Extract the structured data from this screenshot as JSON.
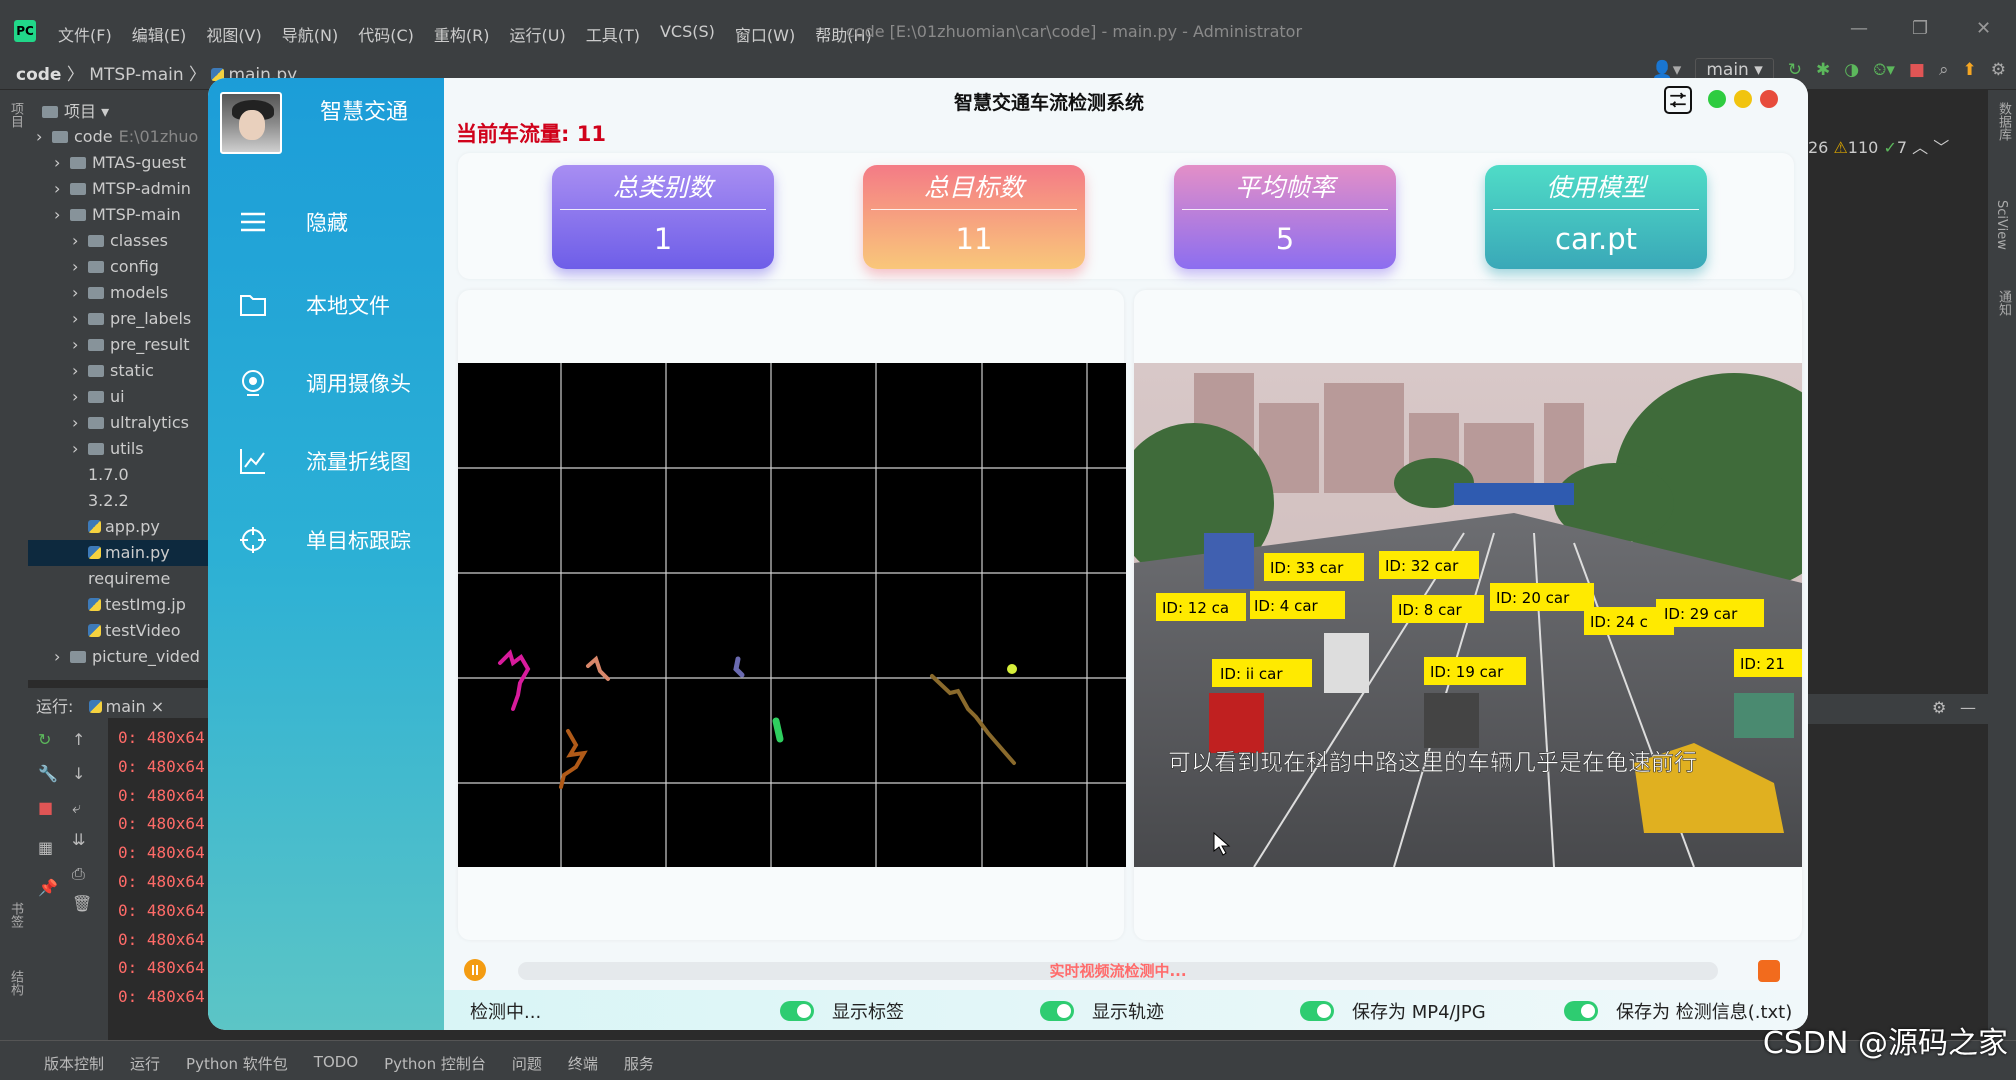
{
  "ide": {
    "logo": "PC",
    "menus": [
      "文件(F)",
      "编辑(E)",
      "视图(V)",
      "导航(N)",
      "代码(C)",
      "重构(R)",
      "运行(U)",
      "工具(T)",
      "VCS(S)",
      "窗口(W)",
      "帮助(H)"
    ],
    "window_title": "code [E:\\01zhuomian\\car\\code] - main.py - Administrator",
    "breadcrumb": [
      "code",
      "MTSP-main",
      "main.py"
    ],
    "branch": "main",
    "project_label": "项目",
    "tree": [
      {
        "name": "code",
        "path": "E:\\01zhuo",
        "level": 0,
        "type": "folder"
      },
      {
        "name": "MTAS-guest",
        "level": 1,
        "type": "folder"
      },
      {
        "name": "MTSP-admin",
        "level": 1,
        "type": "folder"
      },
      {
        "name": "MTSP-main",
        "level": 1,
        "type": "folder"
      },
      {
        "name": "classes",
        "level": 2,
        "type": "folder"
      },
      {
        "name": "config",
        "level": 2,
        "type": "folder"
      },
      {
        "name": "models",
        "level": 2,
        "type": "folder"
      },
      {
        "name": "pre_labels",
        "level": 2,
        "type": "folder"
      },
      {
        "name": "pre_result",
        "level": 2,
        "type": "folder"
      },
      {
        "name": "static",
        "level": 2,
        "type": "folder"
      },
      {
        "name": "ui",
        "level": 2,
        "type": "folder"
      },
      {
        "name": "ultralytics",
        "level": 2,
        "type": "folder"
      },
      {
        "name": "utils",
        "level": 2,
        "type": "folder"
      },
      {
        "name": "1.7.0",
        "level": 2,
        "type": "file"
      },
      {
        "name": "3.2.2",
        "level": 2,
        "type": "file"
      },
      {
        "name": "app.py",
        "level": 2,
        "type": "py"
      },
      {
        "name": "main.py",
        "level": 2,
        "type": "py",
        "selected": true
      },
      {
        "name": "requireme",
        "level": 2,
        "type": "file"
      },
      {
        "name": "testImg.jp",
        "level": 2,
        "type": "py"
      },
      {
        "name": "testVideo",
        "level": 2,
        "type": "py"
      },
      {
        "name": "picture_vided",
        "level": 1,
        "type": "folder"
      }
    ],
    "run_label": "运行:",
    "run_tab": "main",
    "log_lines": [
      "0: 480x64",
      "0: 480x64",
      "0: 480x64",
      "0: 480x64",
      "0: 480x64",
      "0: 480x64",
      "0: 480x64",
      "0: 480x64",
      "0: 480x64",
      "0: 480x64"
    ],
    "inspection": {
      "warnings": "26",
      "weak": "110",
      "typos": "7"
    },
    "status_items": [
      "版本控制",
      "运行",
      "Python 软件包",
      "TODO",
      "Python 控制台",
      "问题",
      "终端",
      "服务"
    ],
    "left_strip": [
      "项目",
      "书签",
      "结构"
    ],
    "right_strip": [
      "数据库",
      "SciView",
      "通知"
    ],
    "watermark": "CSDN @源码之家"
  },
  "app": {
    "sidebar_title": "智慧交通",
    "nav": [
      {
        "label": "隐藏",
        "icon": "menu-icon"
      },
      {
        "label": "本地文件",
        "icon": "folder-icon"
      },
      {
        "label": "调用摄像头",
        "icon": "camera-icon"
      },
      {
        "label": "流量折线图",
        "icon": "line-chart-icon"
      },
      {
        "label": "单目标跟踪",
        "icon": "target-icon"
      }
    ],
    "title": "智慧交通车流检测系统",
    "flow_label": "当前车流量: 11",
    "cards": [
      {
        "label": "总类别数",
        "value": "1"
      },
      {
        "label": "总目标数",
        "value": "11"
      },
      {
        "label": "平均帧率",
        "value": "5"
      },
      {
        "label": "使用模型",
        "value": "car.pt"
      }
    ],
    "progress_text": "实时视频流检测中...",
    "status": "检测中...",
    "toggles": [
      {
        "label": "显示标签",
        "on": true
      },
      {
        "label": "显示轨迹",
        "on": true
      },
      {
        "label": "保存为 MP4/JPG",
        "on": true
      },
      {
        "label": "保存为 检测信息(.txt)",
        "on": true
      }
    ],
    "detections": [
      "ID: 33 car",
      "ID: 32 car",
      "ID: 12 ca",
      "ID: 4 car",
      "ID: 8 car",
      "ID: 20 car",
      "ID: 24 c",
      "ID: 29 car",
      "ID: ii car",
      "ID: 19 car",
      "ID: 21"
    ],
    "subtitle": "可以看到现在科韵中路这里的车辆几乎是在龟速前行"
  },
  "colors": {
    "accent": "#1c9dd8",
    "flow": "#d0021b",
    "progress_text": "#ff6b6b",
    "toggle": "#2ecc71"
  }
}
